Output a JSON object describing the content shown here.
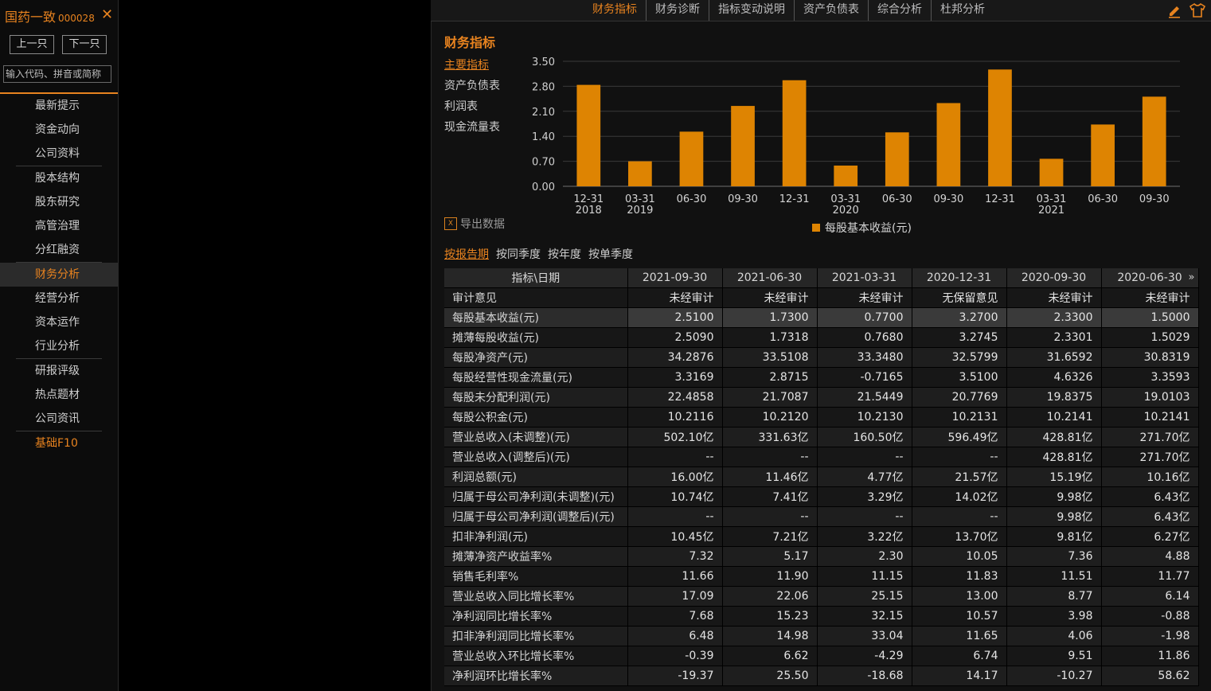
{
  "sidebar": {
    "stock_name": "国药一致",
    "stock_code": "000028",
    "close_label": "✕",
    "prev_label": "上一只",
    "next_label": "下一只",
    "search_placeholder": "输入代码、拼音或简称",
    "groups": [
      [
        "最新提示",
        "资金动向",
        "公司资料"
      ],
      [
        "股本结构",
        "股东研究",
        "高管治理",
        "分红融资"
      ],
      [
        "财务分析",
        "经营分析",
        "资本运作",
        "行业分析"
      ],
      [
        "研报评级",
        "热点题材",
        "公司资讯"
      ],
      [
        "基础F10"
      ]
    ],
    "active_item": "财务分析"
  },
  "topnav": {
    "tabs": [
      "财务指标",
      "财务诊断",
      "指标变动说明",
      "资产负债表",
      "综合分析",
      "杜邦分析"
    ],
    "active_tab": "财务指标",
    "icons": [
      "edit-icon",
      "shirt-icon"
    ]
  },
  "main": {
    "section_title": "财务指标",
    "sub_menu": [
      "主要指标",
      "资产负债表",
      "利润表",
      "现金流量表"
    ],
    "active_sub": "主要指标",
    "export_label": "导出数据",
    "export_icon": "excel-icon",
    "period_tabs": [
      "按报告期",
      "按同季度",
      "按年度",
      "按单季度"
    ],
    "active_period": "按报告期"
  },
  "colors": {
    "accent": "#e8831f",
    "bar": "#de8402",
    "background": "#111111"
  },
  "chart_data": {
    "type": "bar",
    "categories": [
      "12-31 2018",
      "03-31 2019",
      "06-30",
      "09-30",
      "12-31",
      "03-31 2020",
      "06-30",
      "09-30",
      "12-31",
      "03-31 2021",
      "06-30",
      "09-30"
    ],
    "category_lines": [
      [
        "12-31",
        "2018"
      ],
      [
        "03-31",
        "2019"
      ],
      [
        "06-30",
        ""
      ],
      [
        "09-30",
        ""
      ],
      [
        "12-31",
        ""
      ],
      [
        "03-31",
        "2020"
      ],
      [
        "06-30",
        ""
      ],
      [
        "09-30",
        ""
      ],
      [
        "12-31",
        ""
      ],
      [
        "03-31",
        "2021"
      ],
      [
        "06-30",
        ""
      ],
      [
        "09-30",
        ""
      ]
    ],
    "series": [
      {
        "name": "每股基本收益(元)",
        "values": [
          2.84,
          0.7,
          1.53,
          2.25,
          2.97,
          0.58,
          1.51,
          2.33,
          3.27,
          0.77,
          1.73,
          2.51
        ]
      }
    ],
    "yticks": [
      "0.00",
      "0.70",
      "1.40",
      "2.10",
      "2.80",
      "3.50"
    ],
    "ylim": [
      0,
      3.5
    ],
    "grid": true,
    "legend": "bottom"
  },
  "table": {
    "header_label": "指标\\日期",
    "more_icon": "»",
    "dates": [
      "2021-09-30",
      "2021-06-30",
      "2021-03-31",
      "2020-12-31",
      "2020-09-30",
      "2020-06-30"
    ],
    "rows": [
      {
        "label": "审计意见",
        "values": [
          "未经审计",
          "未经审计",
          "未经审计",
          "无保留意见",
          "未经审计",
          "未经审计"
        ]
      },
      {
        "label": "每股基本收益(元)",
        "values": [
          "2.5100",
          "1.7300",
          "0.7700",
          "3.2700",
          "2.3300",
          "1.5000"
        ]
      },
      {
        "label": "摊薄每股收益(元)",
        "values": [
          "2.5090",
          "1.7318",
          "0.7680",
          "3.2745",
          "2.3301",
          "1.5029"
        ]
      },
      {
        "label": "每股净资产(元)",
        "values": [
          "34.2876",
          "33.5108",
          "33.3480",
          "32.5799",
          "31.6592",
          "30.8319"
        ]
      },
      {
        "label": "每股经营性现金流量(元)",
        "values": [
          "3.3169",
          "2.8715",
          "-0.7165",
          "3.5100",
          "4.6326",
          "3.3593"
        ]
      },
      {
        "label": "每股未分配利润(元)",
        "values": [
          "22.4858",
          "21.7087",
          "21.5449",
          "20.7769",
          "19.8375",
          "19.0103"
        ]
      },
      {
        "label": "每股公积金(元)",
        "values": [
          "10.2116",
          "10.2120",
          "10.2130",
          "10.2131",
          "10.2141",
          "10.2141"
        ]
      },
      {
        "label": "营业总收入(未调整)(元)",
        "values": [
          "502.10亿",
          "331.63亿",
          "160.50亿",
          "596.49亿",
          "428.81亿",
          "271.70亿"
        ]
      },
      {
        "label": "营业总收入(调整后)(元)",
        "values": [
          "--",
          "--",
          "--",
          "--",
          "428.81亿",
          "271.70亿"
        ]
      },
      {
        "label": "利润总额(元)",
        "values": [
          "16.00亿",
          "11.46亿",
          "4.77亿",
          "21.57亿",
          "15.19亿",
          "10.16亿"
        ]
      },
      {
        "label": "归属于母公司净利润(未调整)(元)",
        "values": [
          "10.74亿",
          "7.41亿",
          "3.29亿",
          "14.02亿",
          "9.98亿",
          "6.43亿"
        ]
      },
      {
        "label": "归属于母公司净利润(调整后)(元)",
        "values": [
          "--",
          "--",
          "--",
          "--",
          "9.98亿",
          "6.43亿"
        ]
      },
      {
        "label": "扣非净利润(元)",
        "values": [
          "10.45亿",
          "7.21亿",
          "3.22亿",
          "13.70亿",
          "9.81亿",
          "6.27亿"
        ]
      },
      {
        "label": "摊薄净资产收益率%",
        "values": [
          "7.32",
          "5.17",
          "2.30",
          "10.05",
          "7.36",
          "4.88"
        ]
      },
      {
        "label": "销售毛利率%",
        "values": [
          "11.66",
          "11.90",
          "11.15",
          "11.83",
          "11.51",
          "11.77"
        ]
      },
      {
        "label": "营业总收入同比增长率%",
        "values": [
          "17.09",
          "22.06",
          "25.15",
          "13.00",
          "8.77",
          "6.14"
        ]
      },
      {
        "label": "净利润同比增长率%",
        "values": [
          "7.68",
          "15.23",
          "32.15",
          "10.57",
          "3.98",
          "-0.88"
        ]
      },
      {
        "label": "扣非净利润同比增长率%",
        "values": [
          "6.48",
          "14.98",
          "33.04",
          "11.65",
          "4.06",
          "-1.98"
        ]
      },
      {
        "label": "营业总收入环比增长率%",
        "values": [
          "-0.39",
          "6.62",
          "-4.29",
          "6.74",
          "9.51",
          "11.86"
        ]
      },
      {
        "label": "净利润环比增长率%",
        "values": [
          "-19.37",
          "25.50",
          "-18.68",
          "14.17",
          "-10.27",
          "58.62"
        ]
      }
    ],
    "highlighted_row": "每股基本收益(元)"
  }
}
